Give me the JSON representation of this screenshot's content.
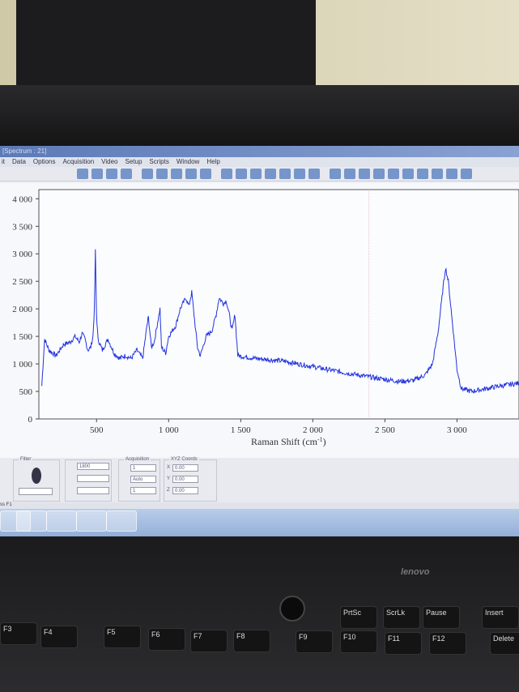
{
  "window": {
    "title": "[Spectrum : 21]"
  },
  "menu": [
    "it",
    "Data",
    "Options",
    "Acquisition",
    "Video",
    "Setup",
    "Scripts",
    "Window",
    "Help"
  ],
  "panels": {
    "filter_label": "Filter",
    "grating_value": "1800",
    "acquisition_label": "Acquisition",
    "acq_values": [
      "1",
      "Auto",
      "1"
    ],
    "xyz_label": "XYZ Coords",
    "xyz": [
      {
        "axis": "X",
        "value": "0.00"
      },
      {
        "axis": "Y",
        "value": "0.00"
      },
      {
        "axis": "Z",
        "value": "0.00"
      }
    ]
  },
  "status_text": "ss F1",
  "keys": [
    "PrtSc",
    "ScrLk",
    "Pause",
    "Insert",
    "F3",
    "F4",
    "F5",
    "F6",
    "F7",
    "F8",
    "F9",
    "F10",
    "F11",
    "F12",
    "Delete"
  ],
  "brand": "lenovo",
  "chart_data": {
    "type": "line",
    "title": "",
    "xlabel": "Raman Shift (cm-1)",
    "xlabel_display": "Raman Shift (cm",
    "xlabel_sup": "-1",
    "xlabel_close": ")",
    "ylabel": "",
    "xlim": [
      100,
      3430
    ],
    "ylim": [
      0,
      4000
    ],
    "xticks": [
      500,
      1000,
      1500,
      2000,
      2500,
      3000
    ],
    "xtick_labels": [
      "500",
      "1 000",
      "1 500",
      "2 000",
      "2 500",
      "3 000"
    ],
    "yticks": [
      0,
      500,
      1000,
      1500,
      2000,
      2500,
      3000,
      3500,
      4000
    ],
    "ytick_labels": [
      "0",
      "500",
      "1 000",
      "1 500",
      "2 000",
      "2 500",
      "3 000",
      "3 500",
      "4 000"
    ],
    "cursor_x": 2390,
    "color": "#2233dd",
    "series": [
      {
        "name": "Spectrum",
        "x": [
          120,
          140,
          170,
          220,
          270,
          320,
          350,
          380,
          400,
          420,
          440,
          460,
          475,
          485,
          492,
          500,
          510,
          540,
          580,
          620,
          660,
          700,
          740,
          780,
          820,
          850,
          860,
          880,
          900,
          940,
          950,
          980,
          1000,
          1050,
          1080,
          1120,
          1140,
          1160,
          1180,
          1200,
          1220,
          1260,
          1300,
          1330,
          1350,
          1380,
          1400,
          1420,
          1440,
          1460,
          1470,
          1480,
          1600,
          1800,
          2000,
          2200,
          2400,
          2600,
          2700,
          2780,
          2830,
          2870,
          2900,
          2920,
          2940,
          2970,
          3000,
          3030,
          3100,
          3200,
          3300,
          3430
        ],
        "y": [
          600,
          1450,
          1250,
          1150,
          1350,
          1400,
          1500,
          1400,
          1550,
          1450,
          1250,
          1300,
          1500,
          2000,
          3050,
          1900,
          1450,
          1250,
          1450,
          1200,
          1100,
          1150,
          1100,
          1250,
          1100,
          1700,
          1850,
          1300,
          1400,
          2000,
          1300,
          1200,
          1500,
          1700,
          2000,
          2200,
          2050,
          2300,
          1800,
          1300,
          1150,
          1500,
          1600,
          1900,
          2200,
          2100,
          2150,
          1900,
          1600,
          1900,
          1500,
          1150,
          1100,
          1050,
          950,
          850,
          760,
          680,
          700,
          800,
          1000,
          1600,
          2300,
          2750,
          2500,
          1700,
          900,
          550,
          500,
          550,
          600,
          650
        ]
      }
    ]
  }
}
